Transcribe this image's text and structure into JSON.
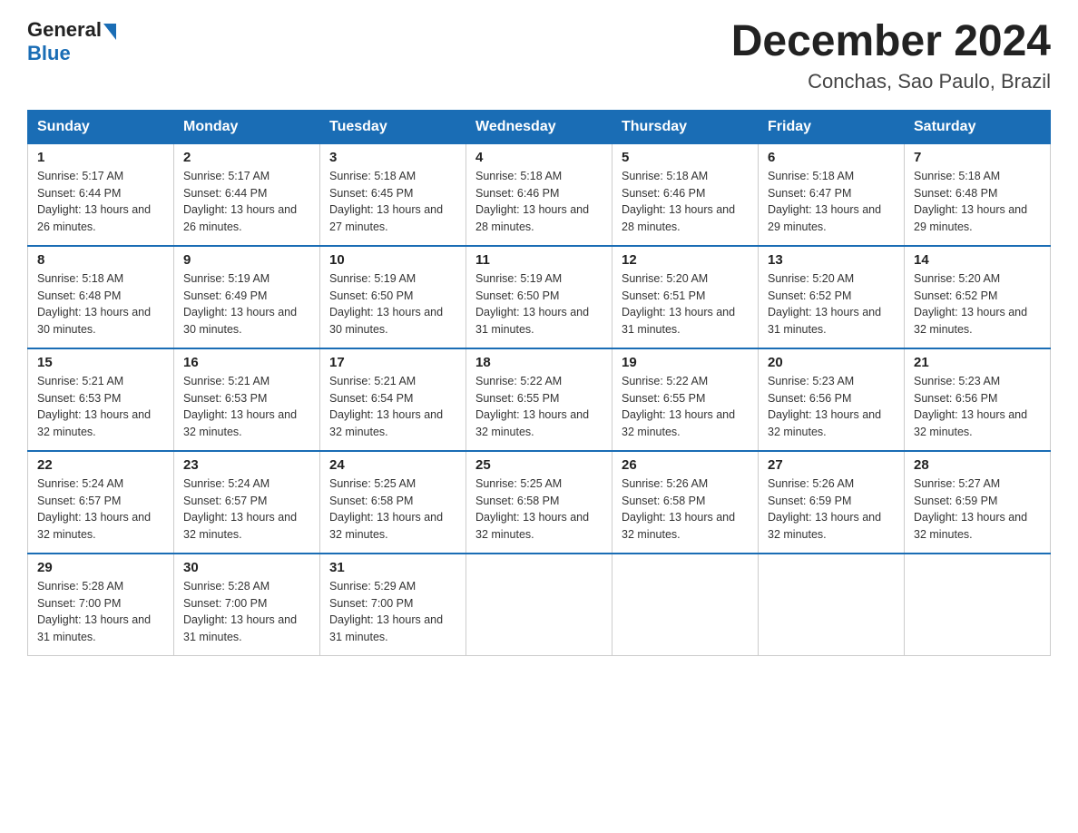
{
  "logo": {
    "general": "General",
    "blue": "Blue"
  },
  "title": "December 2024",
  "subtitle": "Conchas, Sao Paulo, Brazil",
  "header_row": [
    "Sunday",
    "Monday",
    "Tuesday",
    "Wednesday",
    "Thursday",
    "Friday",
    "Saturday"
  ],
  "weeks": [
    [
      {
        "day": "1",
        "sunrise": "5:17 AM",
        "sunset": "6:44 PM",
        "daylight": "13 hours and 26 minutes."
      },
      {
        "day": "2",
        "sunrise": "5:17 AM",
        "sunset": "6:44 PM",
        "daylight": "13 hours and 26 minutes."
      },
      {
        "day": "3",
        "sunrise": "5:18 AM",
        "sunset": "6:45 PM",
        "daylight": "13 hours and 27 minutes."
      },
      {
        "day": "4",
        "sunrise": "5:18 AM",
        "sunset": "6:46 PM",
        "daylight": "13 hours and 28 minutes."
      },
      {
        "day": "5",
        "sunrise": "5:18 AM",
        "sunset": "6:46 PM",
        "daylight": "13 hours and 28 minutes."
      },
      {
        "day": "6",
        "sunrise": "5:18 AM",
        "sunset": "6:47 PM",
        "daylight": "13 hours and 29 minutes."
      },
      {
        "day": "7",
        "sunrise": "5:18 AM",
        "sunset": "6:48 PM",
        "daylight": "13 hours and 29 minutes."
      }
    ],
    [
      {
        "day": "8",
        "sunrise": "5:18 AM",
        "sunset": "6:48 PM",
        "daylight": "13 hours and 30 minutes."
      },
      {
        "day": "9",
        "sunrise": "5:19 AM",
        "sunset": "6:49 PM",
        "daylight": "13 hours and 30 minutes."
      },
      {
        "day": "10",
        "sunrise": "5:19 AM",
        "sunset": "6:50 PM",
        "daylight": "13 hours and 30 minutes."
      },
      {
        "day": "11",
        "sunrise": "5:19 AM",
        "sunset": "6:50 PM",
        "daylight": "13 hours and 31 minutes."
      },
      {
        "day": "12",
        "sunrise": "5:20 AM",
        "sunset": "6:51 PM",
        "daylight": "13 hours and 31 minutes."
      },
      {
        "day": "13",
        "sunrise": "5:20 AM",
        "sunset": "6:52 PM",
        "daylight": "13 hours and 31 minutes."
      },
      {
        "day": "14",
        "sunrise": "5:20 AM",
        "sunset": "6:52 PM",
        "daylight": "13 hours and 32 minutes."
      }
    ],
    [
      {
        "day": "15",
        "sunrise": "5:21 AM",
        "sunset": "6:53 PM",
        "daylight": "13 hours and 32 minutes."
      },
      {
        "day": "16",
        "sunrise": "5:21 AM",
        "sunset": "6:53 PM",
        "daylight": "13 hours and 32 minutes."
      },
      {
        "day": "17",
        "sunrise": "5:21 AM",
        "sunset": "6:54 PM",
        "daylight": "13 hours and 32 minutes."
      },
      {
        "day": "18",
        "sunrise": "5:22 AM",
        "sunset": "6:55 PM",
        "daylight": "13 hours and 32 minutes."
      },
      {
        "day": "19",
        "sunrise": "5:22 AM",
        "sunset": "6:55 PM",
        "daylight": "13 hours and 32 minutes."
      },
      {
        "day": "20",
        "sunrise": "5:23 AM",
        "sunset": "6:56 PM",
        "daylight": "13 hours and 32 minutes."
      },
      {
        "day": "21",
        "sunrise": "5:23 AM",
        "sunset": "6:56 PM",
        "daylight": "13 hours and 32 minutes."
      }
    ],
    [
      {
        "day": "22",
        "sunrise": "5:24 AM",
        "sunset": "6:57 PM",
        "daylight": "13 hours and 32 minutes."
      },
      {
        "day": "23",
        "sunrise": "5:24 AM",
        "sunset": "6:57 PM",
        "daylight": "13 hours and 32 minutes."
      },
      {
        "day": "24",
        "sunrise": "5:25 AM",
        "sunset": "6:58 PM",
        "daylight": "13 hours and 32 minutes."
      },
      {
        "day": "25",
        "sunrise": "5:25 AM",
        "sunset": "6:58 PM",
        "daylight": "13 hours and 32 minutes."
      },
      {
        "day": "26",
        "sunrise": "5:26 AM",
        "sunset": "6:58 PM",
        "daylight": "13 hours and 32 minutes."
      },
      {
        "day": "27",
        "sunrise": "5:26 AM",
        "sunset": "6:59 PM",
        "daylight": "13 hours and 32 minutes."
      },
      {
        "day": "28",
        "sunrise": "5:27 AM",
        "sunset": "6:59 PM",
        "daylight": "13 hours and 32 minutes."
      }
    ],
    [
      {
        "day": "29",
        "sunrise": "5:28 AM",
        "sunset": "7:00 PM",
        "daylight": "13 hours and 31 minutes."
      },
      {
        "day": "30",
        "sunrise": "5:28 AM",
        "sunset": "7:00 PM",
        "daylight": "13 hours and 31 minutes."
      },
      {
        "day": "31",
        "sunrise": "5:29 AM",
        "sunset": "7:00 PM",
        "daylight": "13 hours and 31 minutes."
      },
      null,
      null,
      null,
      null
    ]
  ],
  "labels": {
    "sunrise": "Sunrise:",
    "sunset": "Sunset:",
    "daylight": "Daylight:"
  }
}
